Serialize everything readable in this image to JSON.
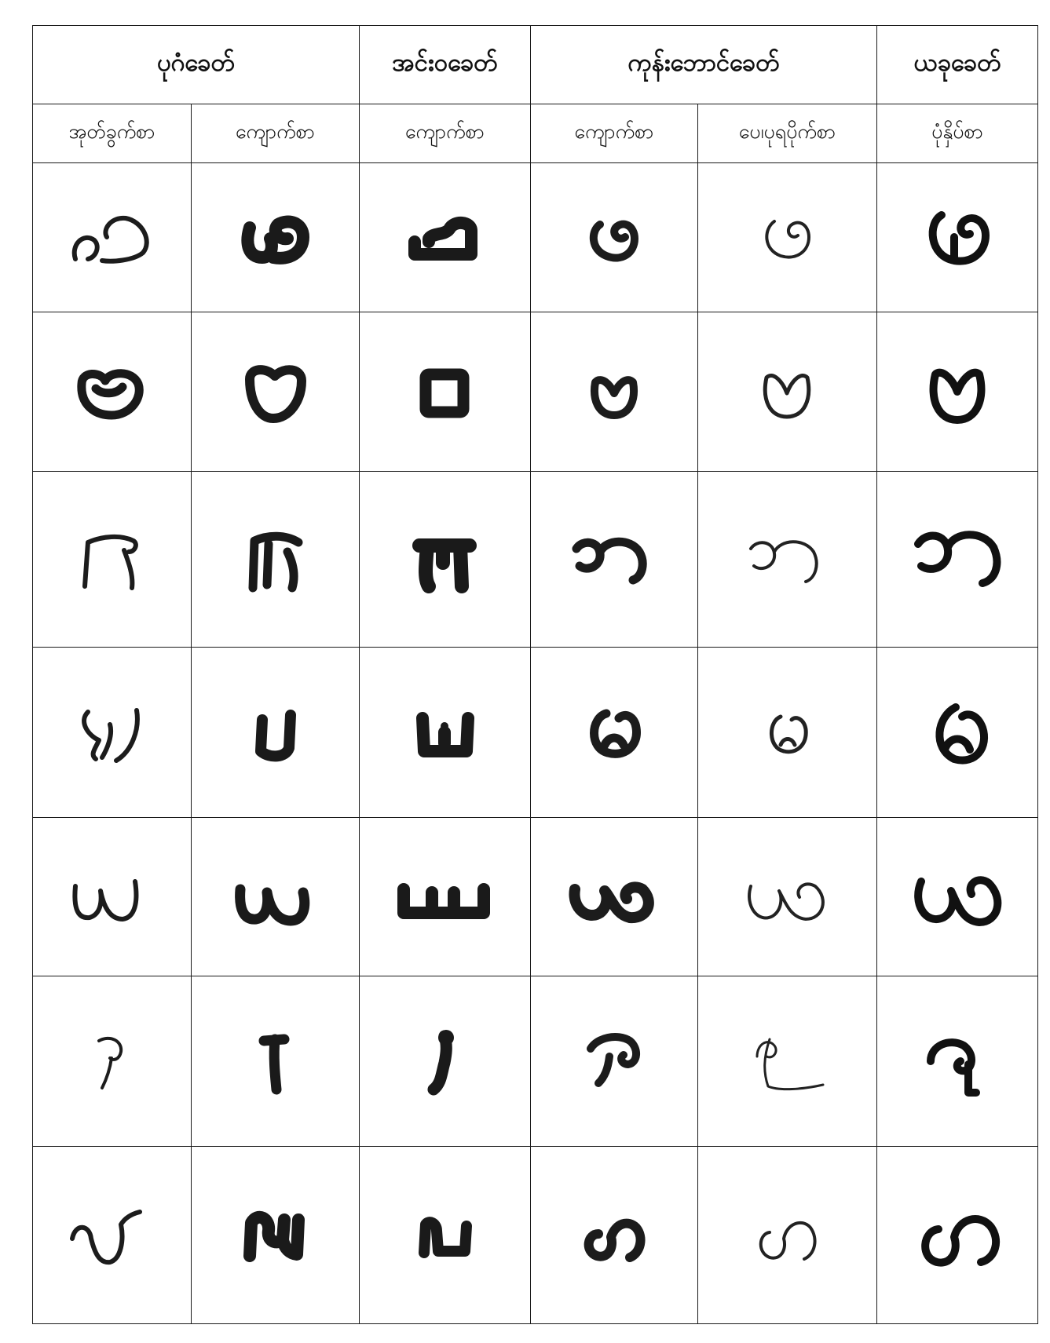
{
  "eras": [
    {
      "label": "ပုဂံခေတ်"
    },
    {
      "label": "အင်းဝခေတ်"
    },
    {
      "label": "ကုန်းဘောင်ခေတ်"
    },
    {
      "label": "ယခုခေတ်"
    }
  ],
  "styles": [
    {
      "label": "အုတ်ခွက်စာ"
    },
    {
      "label": "ကျောက်စာ"
    },
    {
      "label": "ကျောက်စာ"
    },
    {
      "label": "ကျောက်စာ"
    },
    {
      "label": "ပေ၊ပုရပိုက်စာ"
    },
    {
      "label": "ပုံနှိပ်စာ"
    }
  ],
  "rows": [
    {
      "letter": "ဖ",
      "glyph_icon": "letter-pha-icon"
    },
    {
      "letter": "ဗ",
      "glyph_icon": "letter-ba-icon"
    },
    {
      "letter": "ဘ",
      "glyph_icon": "letter-bha-icon"
    },
    {
      "letter": "မ",
      "glyph_icon": "letter-ma-icon"
    },
    {
      "letter": "ယ",
      "glyph_icon": "letter-ya-icon"
    },
    {
      "letter": "ရ",
      "glyph_icon": "letter-ra-icon"
    },
    {
      "letter": "လ",
      "glyph_icon": "letter-la-icon"
    }
  ]
}
